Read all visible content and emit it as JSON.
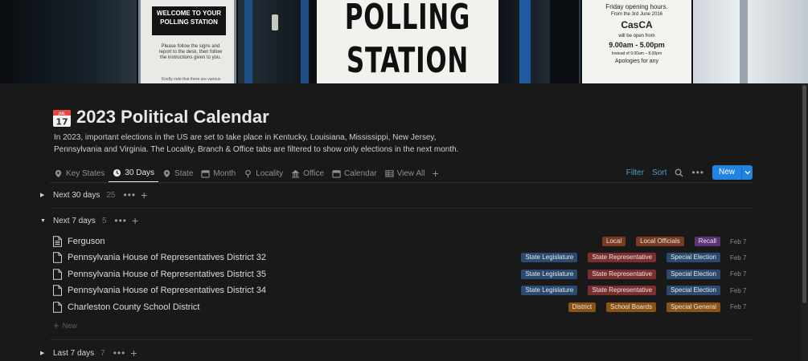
{
  "cover": {
    "sign_left_header": "WELCOME TO YOUR POLLING STATION",
    "sign_left_body": "Please follow the signs and report to the desk, then follow the instructions given to you.",
    "sign_left_footer": "Kindly note that there are various",
    "poll_line1": "POLLING",
    "poll_line2": "STATION",
    "sign_right_l1": "Friday opening hours.",
    "sign_right_l2": "From the 3rd June 2016",
    "sign_right_l3": "CasCA",
    "sign_right_l4": "will be open from",
    "sign_right_l5": "9.00am - 5.00pm",
    "sign_right_l6": "Instead of 9.00am – 8.00pm",
    "sign_right_l7": "Apologies for any"
  },
  "page": {
    "icon": "calendar-icon",
    "title": "2023 Political Calendar",
    "description": "In 2023, important elections in the US are set to take place in Kentucky, Louisiana, Mississippi, New Jersey, Pennsylvania and Virginia. The Locality, Branch & Office tabs are filtered to show only elections in the next month."
  },
  "tabs": [
    {
      "label": "Key States",
      "icon": "map-pin-icon",
      "active": false
    },
    {
      "label": "30 Days",
      "icon": "clock-icon",
      "active": true
    },
    {
      "label": "State",
      "icon": "map-pin-icon",
      "active": false
    },
    {
      "label": "Month",
      "icon": "calendar-icon",
      "active": false
    },
    {
      "label": "Locality",
      "icon": "location-icon",
      "active": false
    },
    {
      "label": "Office",
      "icon": "building-icon",
      "active": false
    },
    {
      "label": "Calendar",
      "icon": "calendar-icon",
      "active": false
    },
    {
      "label": "View All",
      "icon": "table-icon",
      "active": false
    }
  ],
  "toolbar": {
    "filter_label": "Filter",
    "sort_label": "Sort",
    "new_label": "New"
  },
  "groups": {
    "next30": {
      "label": "Next 30 days",
      "count": "25"
    },
    "next7": {
      "label": "Next 7 days",
      "count": "5"
    },
    "last7": {
      "label": "Last 7 days",
      "count": "7"
    }
  },
  "rows": [
    {
      "name": "Ferguson",
      "icon": "document-text-icon",
      "date": "Feb 7",
      "tags": [
        {
          "label": "Local",
          "color": "#7a3a1f"
        },
        {
          "label": "Local Officials",
          "color": "#7a3a1f"
        },
        {
          "label": "Recall",
          "color": "#5b3377"
        }
      ]
    },
    {
      "name": "Pennsylvania House of Representatives District 32",
      "icon": "document-icon",
      "date": "Feb 7",
      "tags": [
        {
          "label": "State Legislature",
          "color": "#2a4a70"
        },
        {
          "label": "State Representative",
          "color": "#7a2e2e"
        },
        {
          "label": "Special Election",
          "color": "#2a4a70"
        }
      ]
    },
    {
      "name": "Pennsylvania House of Representatives District 35",
      "icon": "document-icon",
      "date": "Feb 7",
      "tags": [
        {
          "label": "State Legislature",
          "color": "#2a4a70"
        },
        {
          "label": "State Representative",
          "color": "#7a2e2e"
        },
        {
          "label": "Special Election",
          "color": "#2a4a70"
        }
      ]
    },
    {
      "name": "Pennsylvania House of Representatives District 34",
      "icon": "document-icon",
      "date": "Feb 7",
      "tags": [
        {
          "label": "State Legislature",
          "color": "#2a4a70"
        },
        {
          "label": "State Representative",
          "color": "#7a2e2e"
        },
        {
          "label": "Special Election",
          "color": "#2a4a70"
        }
      ]
    },
    {
      "name": "Charleston County School District",
      "icon": "document-icon",
      "date": "Feb 7",
      "tags": [
        {
          "label": "District",
          "color": "#8a5213"
        },
        {
          "label": "School Boards",
          "color": "#8a5213"
        },
        {
          "label": "Special General",
          "color": "#8a5213"
        }
      ]
    }
  ],
  "new_row_label": "New",
  "colors": {
    "accent": "#2383e2",
    "link": "#529cca",
    "background": "#191919"
  }
}
